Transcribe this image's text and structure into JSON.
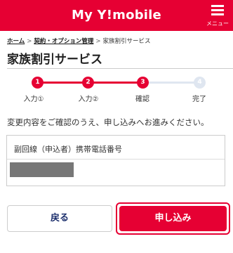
{
  "header": {
    "brand": "My Y!mobile",
    "menu_label": "メニュー",
    "background": "#e60033"
  },
  "breadcrumb": {
    "items": [
      "ホーム",
      "契約・オプション管理",
      "家族割引サービス"
    ],
    "separator": ">"
  },
  "page": {
    "title": "家族割引サービス"
  },
  "stepper": {
    "current_step": 3,
    "steps": [
      {
        "number": "1",
        "label": "入力①",
        "state": "done"
      },
      {
        "number": "2",
        "label": "入力②",
        "state": "done"
      },
      {
        "number": "3",
        "label": "確認",
        "state": "done"
      },
      {
        "number": "4",
        "label": "完了",
        "state": "todo"
      }
    ],
    "active_color": "#e60033",
    "inactive_color": "#dfe6f0"
  },
  "main": {
    "notice": "変更内容をご確認のうえ、申し込みへお進みください。",
    "field_label": "副回線（申込者）携帯電話番号"
  },
  "actions": {
    "back_label": "戻る",
    "apply_label": "申し込み"
  }
}
